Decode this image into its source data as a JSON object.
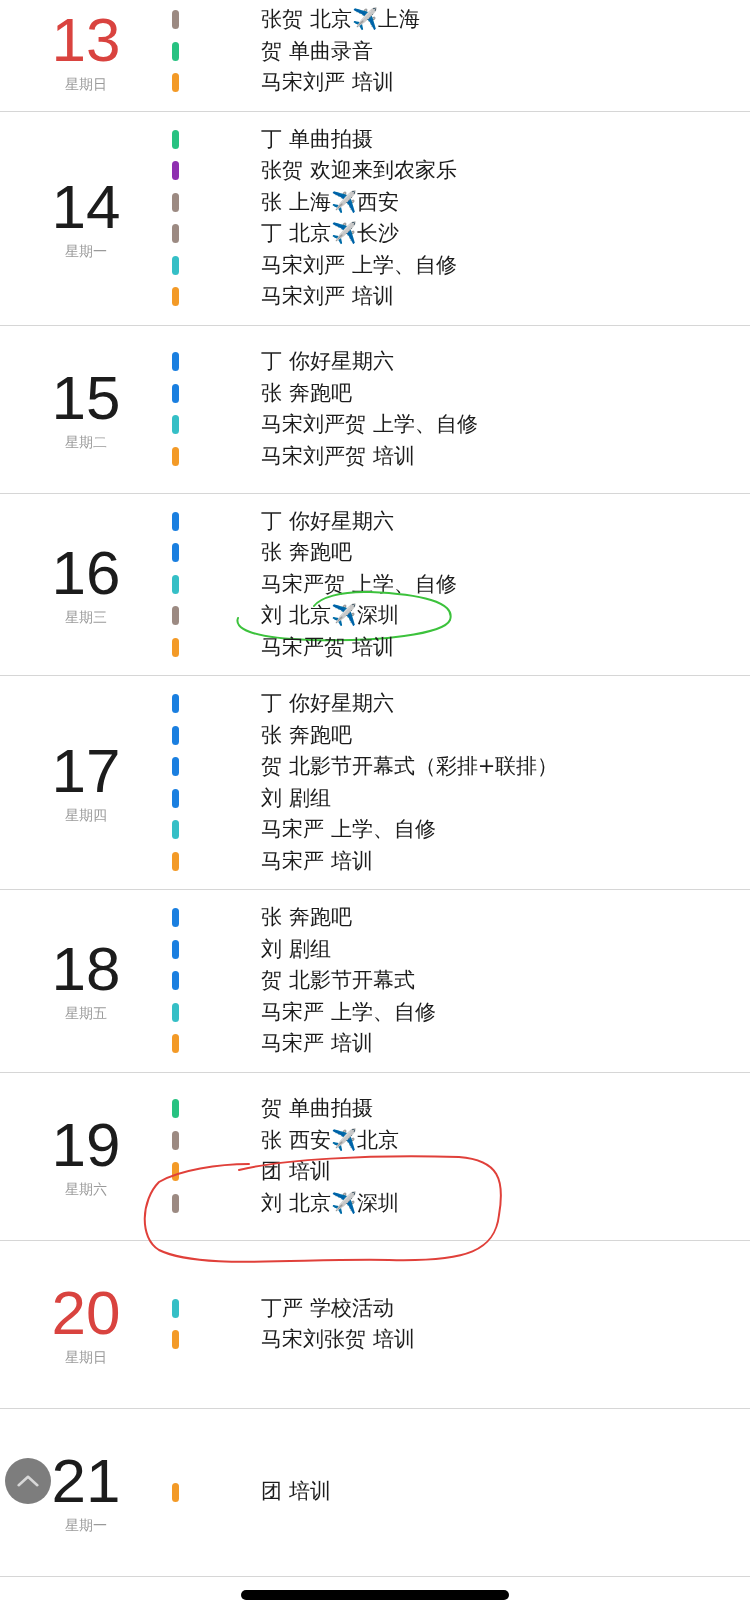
{
  "days": [
    {
      "day": "13",
      "weekday": "星期日",
      "weekend": true,
      "events": [
        {
          "title": "张贺 北京✈️上海",
          "color": "#9c8a82"
        },
        {
          "title": "贺 单曲录音",
          "color": "#27c281"
        },
        {
          "title": "马宋刘严 培训",
          "color": "#f39a27"
        }
      ]
    },
    {
      "day": "14",
      "weekday": "星期一",
      "weekend": false,
      "events": [
        {
          "title": "丁 单曲拍摄",
          "color": "#27c281"
        },
        {
          "title": "张贺 欢迎来到农家乐",
          "color": "#8e2fb0"
        },
        {
          "title": "张 上海✈️西安",
          "color": "#9c8a82"
        },
        {
          "title": "丁 北京✈️长沙",
          "color": "#9c8a82"
        },
        {
          "title": "马宋刘严 上学、自修",
          "color": "#35bfc6"
        },
        {
          "title": "马宋刘严 培训",
          "color": "#f39a27"
        }
      ]
    },
    {
      "day": "15",
      "weekday": "星期二",
      "weekend": false,
      "events": [
        {
          "title": "丁 你好星期六",
          "color": "#1a7fe0"
        },
        {
          "title": "张 奔跑吧",
          "color": "#1a7fe0"
        },
        {
          "title": "马宋刘严贺 上学、自修",
          "color": "#35bfc6"
        },
        {
          "title": "马宋刘严贺 培训",
          "color": "#f39a27"
        }
      ]
    },
    {
      "day": "16",
      "weekday": "星期三",
      "weekend": false,
      "events": [
        {
          "title": "丁 你好星期六",
          "color": "#1a7fe0"
        },
        {
          "title": "张 奔跑吧",
          "color": "#1a7fe0"
        },
        {
          "title": "马宋严贺 上学、自修",
          "color": "#35bfc6"
        },
        {
          "title": "刘 北京✈️深圳",
          "color": "#9c8a82",
          "circle": {
            "color": "#3cc23c"
          }
        },
        {
          "title": "马宋严贺 培训",
          "color": "#f39a27"
        }
      ]
    },
    {
      "day": "17",
      "weekday": "星期四",
      "weekend": false,
      "events": [
        {
          "title": "丁 你好星期六",
          "color": "#1a7fe0"
        },
        {
          "title": "张 奔跑吧",
          "color": "#1a7fe0"
        },
        {
          "title": "贺 北影节开幕式（彩排+联排）",
          "color": "#1a7fe0"
        },
        {
          "title": "刘 剧组",
          "color": "#1a7fe0"
        },
        {
          "title": "马宋严 上学、自修",
          "color": "#35bfc6"
        },
        {
          "title": "马宋严 培训",
          "color": "#f39a27"
        }
      ]
    },
    {
      "day": "18",
      "weekday": "星期五",
      "weekend": false,
      "events": [
        {
          "title": "张 奔跑吧",
          "color": "#1a7fe0"
        },
        {
          "title": "刘 剧组",
          "color": "#1a7fe0"
        },
        {
          "title": "贺 北影节开幕式",
          "color": "#1a7fe0"
        },
        {
          "title": "马宋严 上学、自修",
          "color": "#35bfc6"
        },
        {
          "title": "马宋严 培训",
          "color": "#f39a27"
        }
      ]
    },
    {
      "day": "19",
      "weekday": "星期六",
      "weekend": false,
      "events": [
        {
          "title": "贺 单曲拍摄",
          "color": "#27c281"
        },
        {
          "title": "张 西安✈️北京",
          "color": "#9c8a82"
        },
        {
          "title": "团 培训",
          "color": "#f39a27"
        },
        {
          "title": "刘 北京✈️深圳",
          "color": "#9c8a82",
          "circle": {
            "color": "#e0403a"
          }
        }
      ]
    },
    {
      "day": "20",
      "weekday": "星期日",
      "weekend": true,
      "events": [
        {
          "title": "丁严 学校活动",
          "color": "#35bfc6"
        },
        {
          "title": "马宋刘张贺 培训",
          "color": "#f39a27"
        }
      ]
    },
    {
      "day": "21",
      "weekday": "星期一",
      "weekend": false,
      "events": [
        {
          "title": "团 培训",
          "color": "#f39a27"
        }
      ]
    }
  ]
}
